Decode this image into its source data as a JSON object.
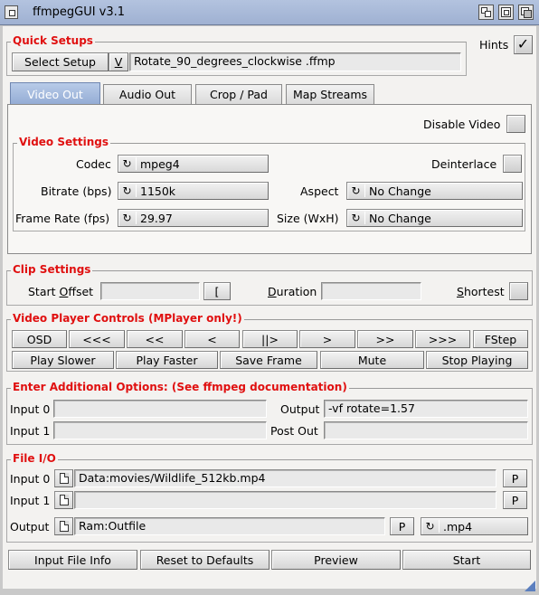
{
  "window": {
    "title": "ffmpegGUI  v3.1"
  },
  "quick_setups": {
    "group_title": "Quick Setups",
    "select_label": "Select Setup",
    "popup_glyph": "V",
    "setup_value": "Rotate_90_degrees_clockwise .ffmp",
    "hints_label": "Hints",
    "hints_checked": "✓"
  },
  "tabs": [
    {
      "label": "Video Out",
      "active": true
    },
    {
      "label": "Audio Out",
      "active": false
    },
    {
      "label": "Crop / Pad",
      "active": false
    },
    {
      "label": "Map Streams",
      "active": false
    }
  ],
  "video_out": {
    "disable_video_label": "Disable Video",
    "settings_title": "Video Settings",
    "codec_label": "Codec",
    "codec_value": "mpeg4",
    "deinterlace_label": "Deinterlace",
    "bitrate_label": "Bitrate (bps)",
    "bitrate_value": "1150k",
    "aspect_label": "Aspect",
    "aspect_value": "No Change",
    "framerate_label": "Frame Rate (fps)",
    "framerate_value": "29.97",
    "size_label": "Size (WxH)",
    "size_value": "No Change"
  },
  "clip": {
    "title": "Clip Settings",
    "start_offset_pre": "Start ",
    "start_offset_u": "O",
    "start_offset_post": "ffset",
    "start_offset_value": "",
    "bracket_button": "[",
    "duration_u": "D",
    "duration_post": "uration",
    "duration_value": "",
    "shortest_u": "S",
    "shortest_post": "hortest"
  },
  "player": {
    "title": "Video Player Controls (MPlayer only!)",
    "row1": [
      "OSD",
      "<<<",
      "<<",
      "<",
      "||>",
      ">",
      ">>",
      ">>>",
      "FStep"
    ],
    "row2": [
      "Play Slower",
      "Play Faster",
      "Save Frame",
      "Mute",
      "Stop Playing"
    ]
  },
  "options": {
    "title": "Enter Additional Options:    (See ffmpeg documentation)",
    "input0_label": "Input 0",
    "input0_value": "",
    "input1_label": "Input 1",
    "input1_value": "",
    "output_label": "Output",
    "output_value": "-vf rotate=1.57",
    "postout_label": "Post Out",
    "postout_value": ""
  },
  "fileio": {
    "title": "File I/O",
    "input0_label": "Input 0",
    "input0_value": "Data:movies/Wildlife_512kb.mp4",
    "input1_label": "Input 1",
    "input1_value": "",
    "output_label": "Output",
    "output_value": "Ram:Outfile",
    "p_button": "P",
    "ext_value": ".mp4"
  },
  "actions": [
    "Input File Info",
    "Reset to Defaults",
    "Preview",
    "Start"
  ],
  "icons": {
    "cycle": "cycle-icon",
    "file": "file-icon"
  }
}
